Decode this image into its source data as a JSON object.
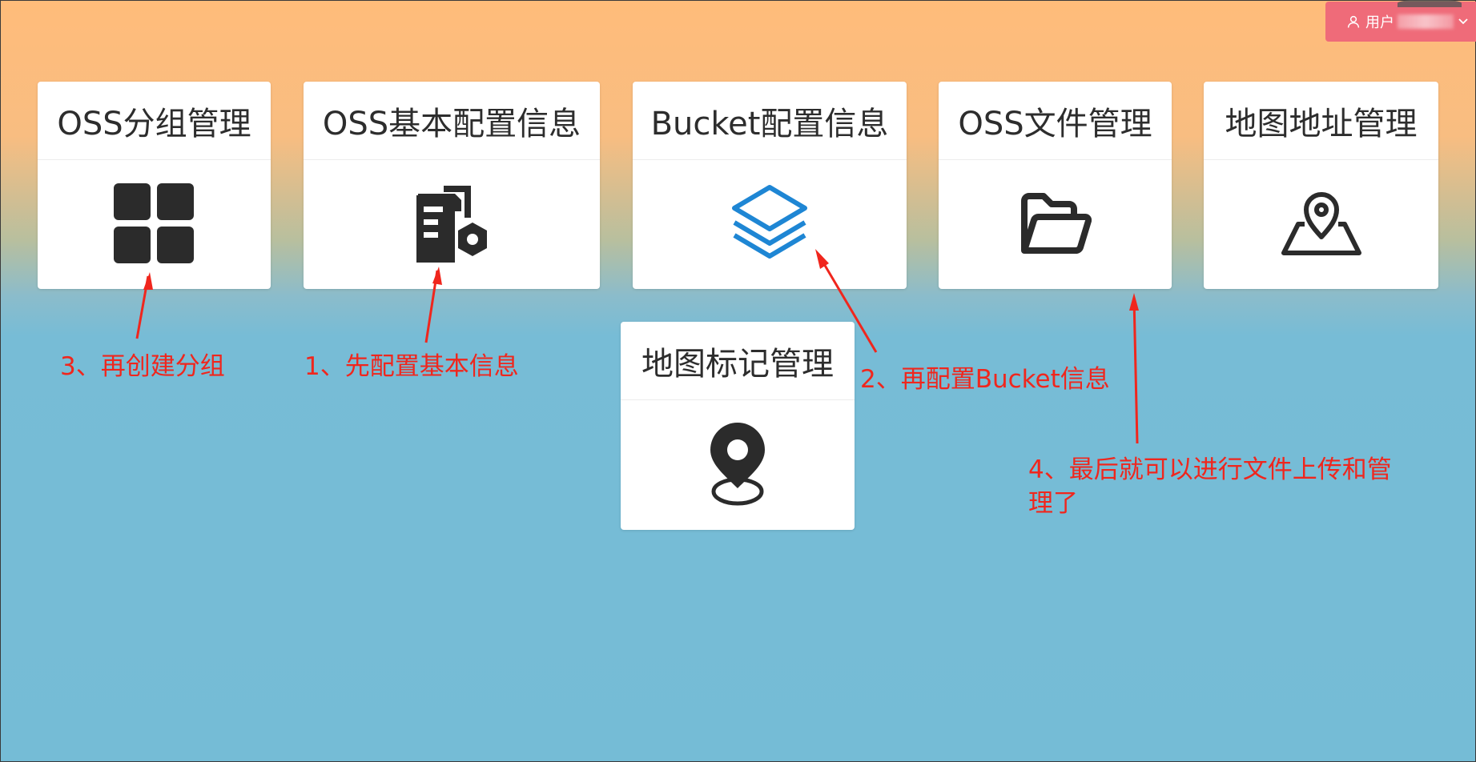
{
  "header": {
    "user_label": "用户",
    "user_icon": "user-icon",
    "dropdown_icon": "chevron-down-icon"
  },
  "cards": [
    {
      "title": "OSS分组管理",
      "icon": "grid-four-squares-icon"
    },
    {
      "title": "OSS基本配置信息",
      "icon": "document-settings-icon"
    },
    {
      "title": "Bucket配置信息",
      "icon": "layers-icon"
    },
    {
      "title": "OSS文件管理",
      "icon": "folder-icon"
    },
    {
      "title": "地图地址管理",
      "icon": "map-location-icon"
    },
    {
      "title": "地图标记管理",
      "icon": "map-marker-icon"
    }
  ],
  "annotations": {
    "step1": "1、先配置基本信息",
    "step2": "2、再配置Bucket信息",
    "step3": "3、再创建分组",
    "step4_line1": "4、最后就可以进行文件上传和管",
    "step4_line2": "理了"
  },
  "colors": {
    "accent_red": "#f0261d",
    "user_button": "#ef6b79",
    "bucket_icon_blue": "#1e86d4",
    "icon_dark": "#2b2b2b"
  }
}
